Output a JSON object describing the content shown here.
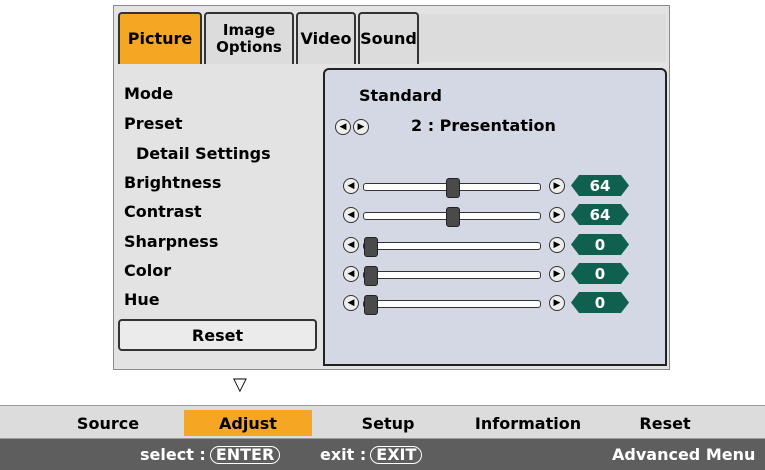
{
  "tabs": [
    {
      "label": "Picture"
    },
    {
      "label": "Image Options"
    },
    {
      "label": "Video"
    },
    {
      "label": "Sound"
    }
  ],
  "items": {
    "mode": "Mode",
    "preset": "Preset",
    "detail": "Detail Settings",
    "brightness": "Brightness",
    "contrast": "Contrast",
    "sharpness": "Sharpness",
    "color": "Color",
    "hue": "Hue",
    "reset": "Reset"
  },
  "values": {
    "mode": "Standard",
    "preset": "2 : Presentation",
    "brightness": "64",
    "contrast": "64",
    "sharpness": "0",
    "color": "0",
    "hue": "0"
  },
  "sliders": {
    "brightness": 0.5,
    "contrast": 0.5,
    "sharpness": 0.0,
    "color": 0.0,
    "hue": 0.0
  },
  "menu": [
    "Source",
    "Adjust",
    "Setup",
    "Information",
    "Reset"
  ],
  "status": {
    "select_label": "select :",
    "select_key": "ENTER",
    "exit_label": "exit :",
    "exit_key": "EXIT",
    "advanced": "Advanced Menu"
  },
  "colors": {
    "accent": "#f5a623",
    "value_badge": "#106050"
  }
}
